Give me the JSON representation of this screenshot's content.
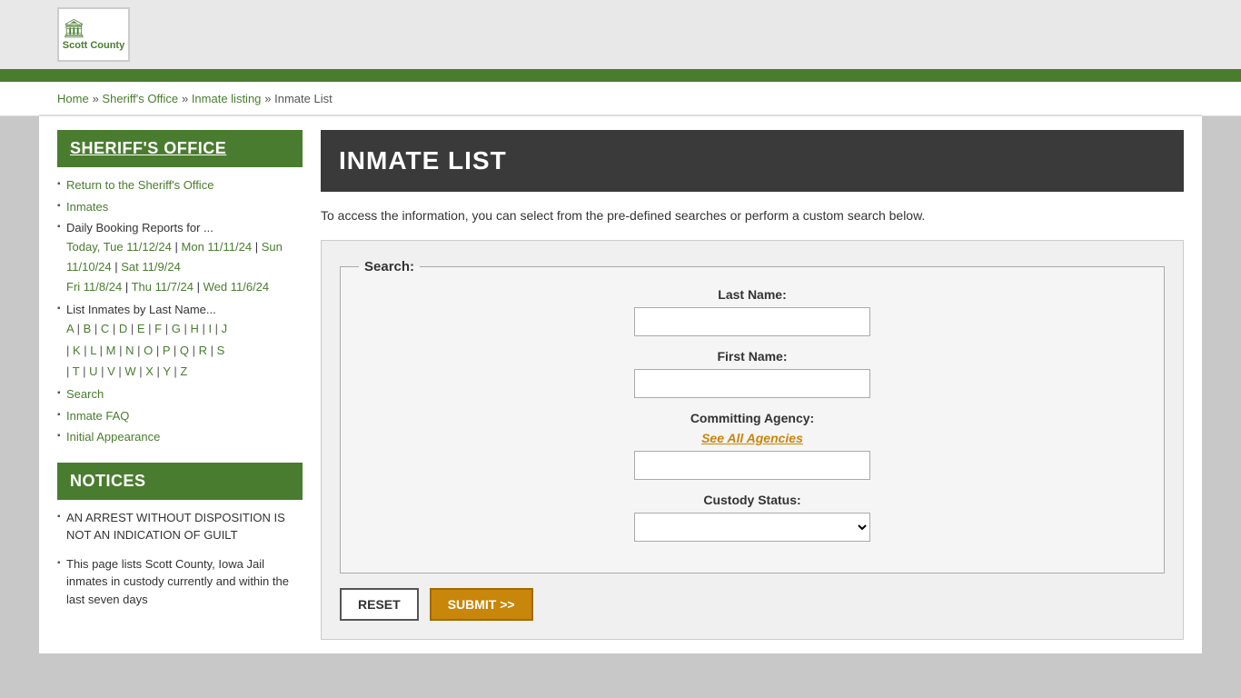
{
  "site": {
    "logo_name": "Scott County",
    "logo_icon": "🏛"
  },
  "breadcrumb": {
    "home": "Home",
    "sheriff": "Sheriff's Office",
    "inmate_listing": "Inmate listing",
    "current": "Inmate List"
  },
  "sidebar": {
    "section1_title": "SHERIFF'S OFFICE",
    "return_link": "Return to the Sheriff's Office",
    "inmates_link": "Inmates",
    "daily_booking_label": "Daily Booking Reports for ...",
    "today_label": "Today, Tue 11/12/24",
    "mon_label": "Mon 11/11/24",
    "sun_label": "Sun 11/10/24",
    "sat_label": "Sat 11/9/24",
    "fri_label": "Fri 11/8/24",
    "thu_label": "Thu 11/7/24",
    "wed_label": "Wed 11/6/24",
    "list_by_name": "List Inmates by Last Name...",
    "alpha": [
      "A",
      "B",
      "C",
      "D",
      "E",
      "F",
      "G",
      "H",
      "I",
      "J",
      "K",
      "L",
      "M",
      "N",
      "O",
      "P",
      "Q",
      "R",
      "S",
      "T",
      "U",
      "V",
      "W",
      "X",
      "Y",
      "Z"
    ],
    "search_label": "Search",
    "faq_label": "Inmate FAQ",
    "initial_appearance": "Initial Appearance",
    "section2_title": "NOTICES",
    "notice1": "AN ARREST WITHOUT DISPOSITION IS NOT AN INDICATION OF GUILT",
    "notice2": "This page lists Scott County, Iowa Jail inmates in custody currently and within the last seven days"
  },
  "main": {
    "page_title": "INMATE LIST",
    "intro": "To access the information, you can select from the pre-defined searches or perform a custom search below.",
    "form": {
      "legend": "Search:",
      "last_name_label": "Last Name:",
      "first_name_label": "First Name:",
      "committing_agency_label": "Committing Agency:",
      "see_all_agencies": "See All Agencies",
      "custody_status_label": "Custody Status:",
      "reset_btn": "RESET",
      "submit_btn": "SUBMIT >>"
    }
  }
}
